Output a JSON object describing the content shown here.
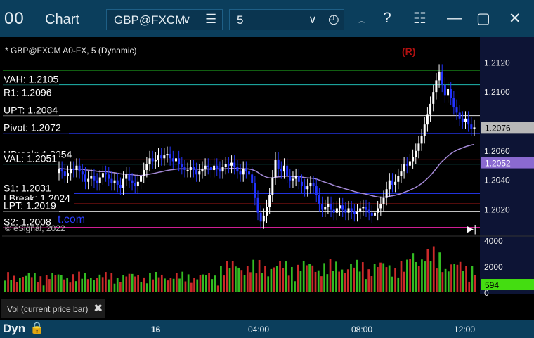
{
  "window": {
    "app_title": "Chart",
    "app_icon": "00",
    "symbol": "GBP@FXCM",
    "interval": "5",
    "icons": [
      "chevron-down-icon",
      "menu-icon",
      "chevron-down-icon",
      "clock-icon",
      "draw-icon",
      "help-icon",
      "layout-icon",
      "minimize-icon",
      "maximize-icon",
      "close-icon"
    ]
  },
  "chart_header": "* GBP@FXCM A0-FX, 5 (Dynamic)",
  "marker_r": "(R)",
  "copyright": "© eSignal, 2022",
  "watermark": "t.com",
  "price_tag": "1.2076",
  "vwap_tag": "1.2052",
  "volume_tag": "594",
  "vol_tab_label": "Vol (current price bar)",
  "bottom": {
    "dyn": "Dyn",
    "time_labels": [
      "16",
      "04:00",
      "08:00",
      "12:00"
    ]
  },
  "colors": {
    "background": "#000000",
    "up_candle": "#ffffff",
    "down_candle": "#2233ff",
    "price_tag": "#b8b8b8",
    "vwap_tag": "#8a6ad0",
    "volume_tag": "#44dd11",
    "title_bar": "#0b3e5c",
    "marker_r": "#b01010"
  },
  "chart_data": {
    "type": "candlestick",
    "title": "* GBP@FXCM A0-FX, 5 (Dynamic)",
    "ylim": [
      1.2004,
      1.2134
    ],
    "y_ticks": [
      "1.2120",
      "1.2100",
      "1.2060",
      "1.2040",
      "1.2020"
    ],
    "x_ticks": [
      "16",
      "04:00",
      "08:00",
      "12:00"
    ],
    "levels": [
      {
        "label": "VAH: 1.2105",
        "value": 1.2105,
        "color": "#1fb8b0"
      },
      {
        "label": "R1: 1.2096",
        "value": 1.2096,
        "color": "#2233dd"
      },
      {
        "label": "UPT: 1.2084",
        "value": 1.2084,
        "color": "#dddddd"
      },
      {
        "label": "Pivot: 1.2072",
        "value": 1.2072,
        "color": "#2233dd"
      },
      {
        "label": "UBreak: 1.2054",
        "value": 1.2054,
        "color": "#dd2222"
      },
      {
        "label": "VAL: 1.2051",
        "value": 1.2051,
        "color": "#1fb8b0"
      },
      {
        "label": "S1: 1.2031",
        "value": 1.2031,
        "color": "#2233dd"
      },
      {
        "label": "LBreak: 1.2024",
        "value": 1.2024,
        "color": "#dd2222"
      },
      {
        "label": "LPT: 1.2019",
        "value": 1.2019,
        "color": "#dddddd"
      },
      {
        "label": "S2: 1.2008",
        "value": 1.2008,
        "color": "#ee22aa"
      }
    ],
    "top_level": 1.2115,
    "last_price": 1.2076,
    "vwap_last": 1.2052,
    "closes": [
      1.2048,
      1.2046,
      1.2043,
      1.2045,
      1.2048,
      1.2047,
      1.205,
      1.2046,
      1.2044,
      1.2039,
      1.2041,
      1.2043,
      1.204,
      1.2038,
      1.2042,
      1.2045,
      1.2044,
      1.2041,
      1.2038,
      1.204,
      1.2037,
      1.2035,
      1.2041,
      1.2044,
      1.204,
      1.2038,
      1.2036,
      1.2039,
      1.2043,
      1.2047,
      1.2051,
      1.2055,
      1.2053,
      1.2054,
      1.2057,
      1.2055,
      1.2057,
      1.2058,
      1.2055,
      1.2053,
      1.2055,
      1.2051,
      1.2049,
      1.2047,
      1.2047,
      1.2049,
      1.2047,
      1.2044,
      1.2046,
      1.2048,
      1.205,
      1.2049,
      1.2047,
      1.205,
      1.2048,
      1.2046,
      1.2049,
      1.2051,
      1.205,
      1.2052,
      1.2049,
      1.2046,
      1.2044,
      1.2048,
      1.2046,
      1.2044,
      1.2038,
      1.2028,
      1.2018,
      1.2012,
      1.2016,
      1.2022,
      1.203,
      1.2042,
      1.2054,
      1.2048,
      1.2046,
      1.205,
      1.2043,
      1.204,
      1.2041,
      1.2043,
      1.2039,
      1.2036,
      1.2034,
      1.2036,
      1.2038,
      1.2036,
      1.203,
      1.2024,
      1.202,
      1.2022,
      1.2024,
      1.202,
      1.2018,
      1.2021,
      1.2023,
      1.202,
      1.2018,
      1.2021,
      1.2019,
      1.2017,
      1.2019,
      1.2021,
      1.2022,
      1.202,
      1.2018,
      1.2016,
      1.2018,
      1.2021,
      1.2024,
      1.2028,
      1.2034,
      1.204,
      1.2037,
      1.2039,
      1.2043,
      1.2046,
      1.2051,
      1.205,
      1.2053,
      1.2056,
      1.206,
      1.2065,
      1.207,
      1.2078,
      1.2085,
      1.2092,
      1.21,
      1.2108,
      1.2114,
      1.2105,
      1.2098,
      1.2102,
      1.2096,
      1.209,
      1.2086,
      1.2082,
      1.208,
      1.2082,
      1.2078,
      1.2075,
      1.2076
    ],
    "volume": {
      "ylim": [
        0,
        4000
      ],
      "y_ticks": [
        "4000",
        "2000",
        "0"
      ],
      "last": 594
    }
  }
}
